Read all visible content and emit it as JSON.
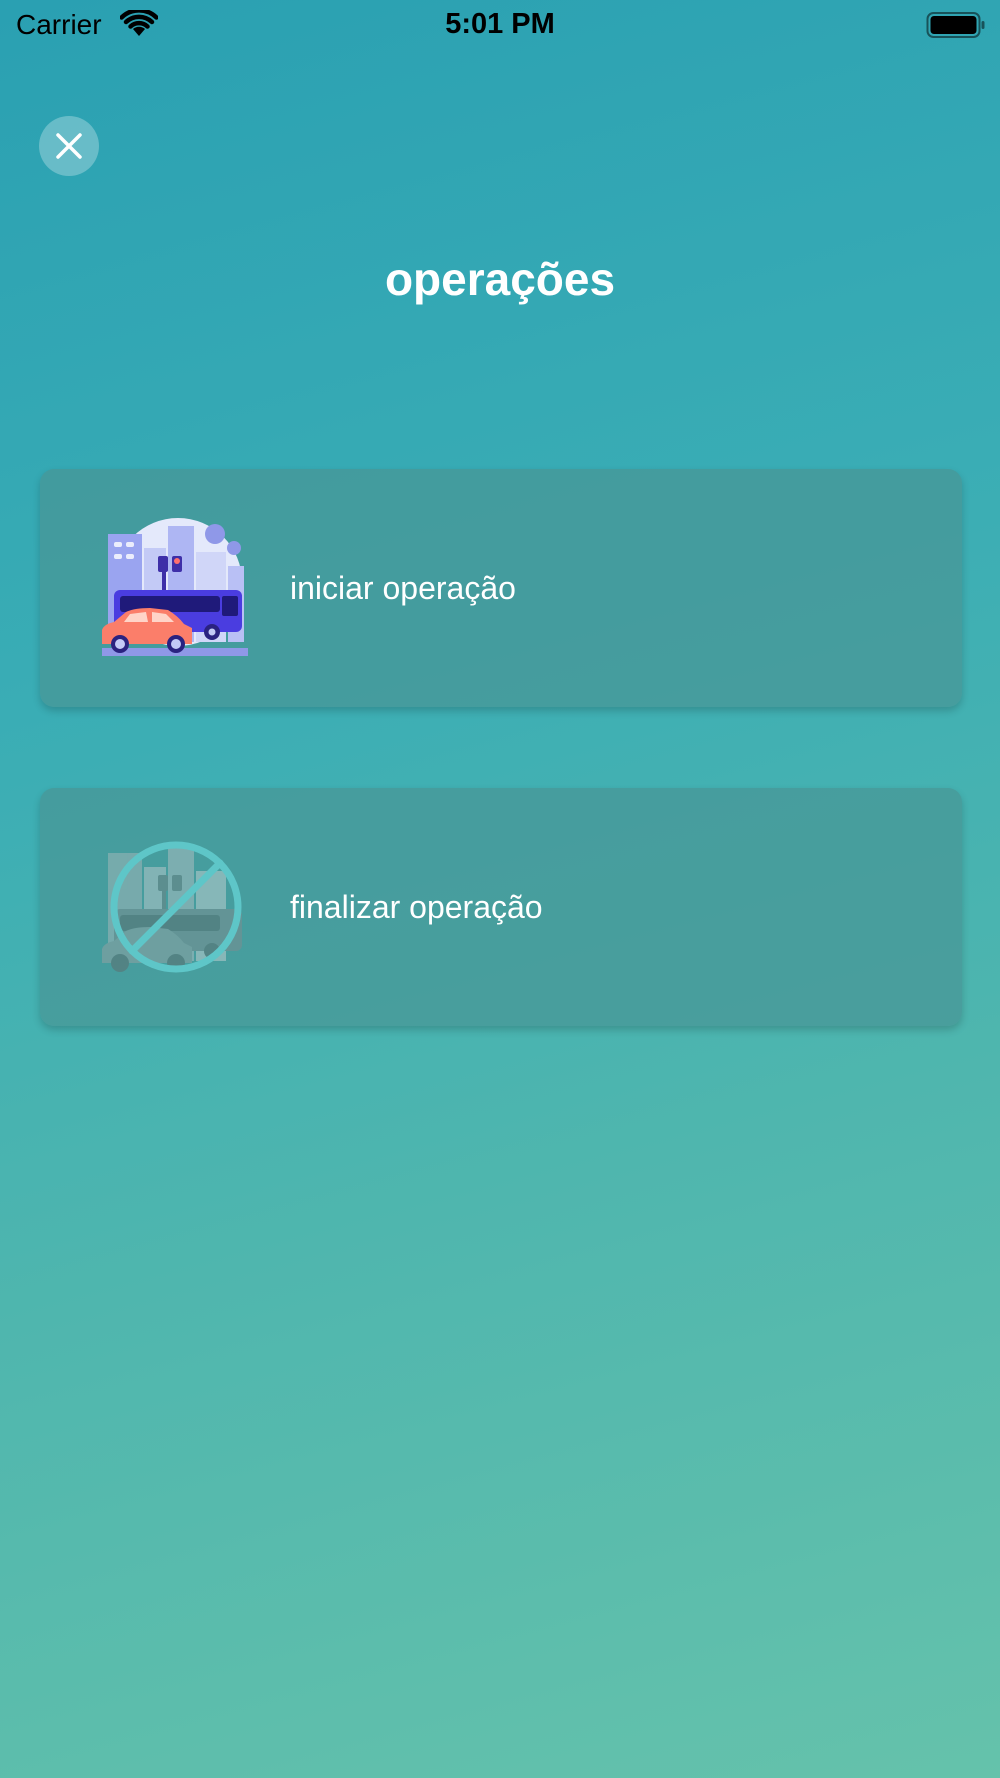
{
  "status_bar": {
    "carrier": "Carrier",
    "time": "5:01 PM",
    "wifi_icon": "wifi-icon",
    "battery_icon": "battery-icon"
  },
  "header": {
    "close_icon": "close-icon",
    "title": "operações"
  },
  "options": [
    {
      "label": "iniciar operação",
      "icon": "city-traffic-illustration",
      "enabled": true
    },
    {
      "label": "finalizar operação",
      "icon": "city-traffic-prohibited-illustration",
      "enabled": true
    }
  ],
  "colors": {
    "background_top": "#2aa0b2",
    "background_bottom": "#65c2ab",
    "card": "#4a9696",
    "text": "#ffffff"
  }
}
